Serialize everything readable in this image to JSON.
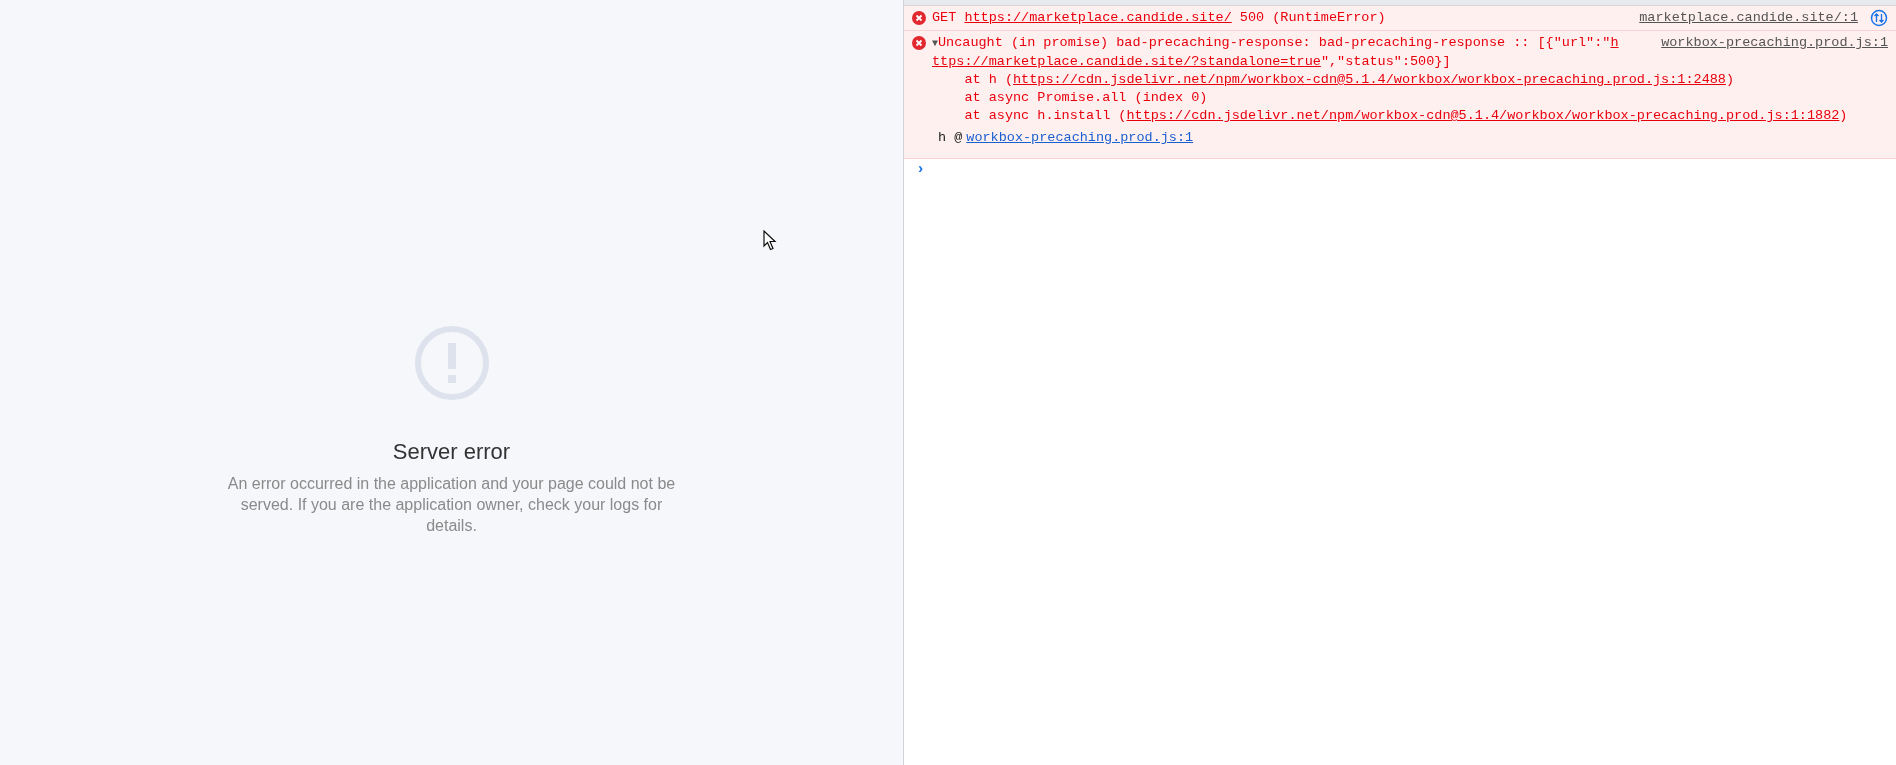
{
  "page": {
    "title": "Server error",
    "message": "An error occurred in the application and your page could not be served. If you are the application owner, check your logs for details."
  },
  "console": {
    "messages": [
      {
        "kind": "error",
        "source": "marketplace.candide.site/:1",
        "badge": true,
        "lines": [
          [
            {
              "text": "GET ",
              "link": false
            },
            {
              "text": "https://marketplace.candide.site/",
              "link": true
            },
            {
              "text": " 500 (RuntimeError)",
              "link": false
            }
          ]
        ]
      },
      {
        "kind": "error",
        "expanded": true,
        "toggle": "▼",
        "source": "workbox-precaching.prod.js:1",
        "badge": false,
        "lines": [
          [
            {
              "text": "Uncaught (in promise) bad-precaching-response: bad-precaching-response :: [{\"url\":\"",
              "link": false
            },
            {
              "text": "h",
              "link": true
            }
          ],
          [
            {
              "text": "ttps://marketplace.candide.site/?standalone=true",
              "link": true
            },
            {
              "text": "\",\"status\":500}]",
              "link": false
            }
          ],
          [
            {
              "text": "    at h (",
              "link": false
            },
            {
              "text": "https://cdn.jsdelivr.net/npm/workbox-cdn@5.1.4/workbox/workbox-precaching.prod.js:1:2488",
              "link": true
            },
            {
              "text": ")",
              "link": false
            }
          ],
          [
            {
              "text": "    at async Promise.all (index 0)",
              "link": false
            }
          ],
          [
            {
              "text": "    at async h.install (",
              "link": false
            },
            {
              "text": "https://cdn.jsdelivr.net/npm/workbox-cdn@5.1.4/workbox/workbox-precaching.prod.js:1:1882",
              "link": true
            },
            {
              "text": ")",
              "link": false
            }
          ]
        ],
        "caller": {
          "name": "h @",
          "link": "workbox-precaching.prod.js:1"
        }
      }
    ],
    "prompt": "›"
  }
}
